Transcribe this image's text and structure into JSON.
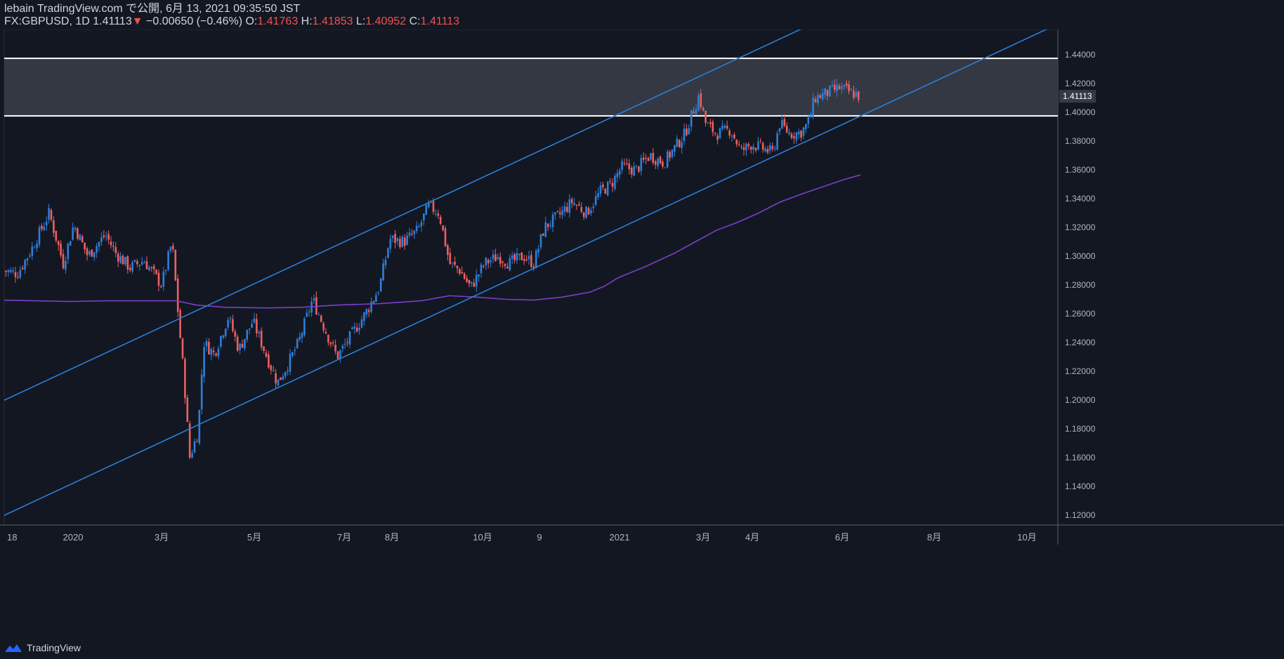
{
  "header": {
    "publish_line": "lebain TradingView.com で公開, 6月 13, 2021 09:35:50 JST",
    "symbol": "FX:GBPUSD, 1D",
    "last": "1.41113",
    "change_arrow": "▼",
    "change": "−0.00650 (−0.46%)",
    "open_label": "O:",
    "open": "1.41763",
    "high_label": "H:",
    "high": "1.41853",
    "low_label": "L:",
    "low": "1.40952",
    "close_label": "C:",
    "close": "1.41113"
  },
  "footer": {
    "brand": "TradingView"
  },
  "colors": {
    "background": "#131722",
    "up": "#2d7fd9",
    "down": "#ef5f5f",
    "channel": "#2a7fd6",
    "zone_fill": "#363a45",
    "zone_line": "#ffffff",
    "ma": "#7b3fc9",
    "price_tag": "#363a45"
  },
  "chart_data": {
    "type": "candlestick",
    "ylim": [
      1.11,
      1.45
    ],
    "y_ticks": [
      "1.44000",
      "1.42000",
      "1.40000",
      "1.38000",
      "1.36000",
      "1.34000",
      "1.32000",
      "1.30000",
      "1.28000",
      "1.26000",
      "1.24000",
      "1.22000",
      "1.20000",
      "1.18000",
      "1.16000",
      "1.14000",
      "1.12000"
    ],
    "x_ticks": [
      "18",
      "2020",
      "3月",
      "5月",
      "7月",
      "8月",
      "10月",
      "9",
      "2021",
      "3月",
      "4月",
      "6月",
      "8月",
      "10月"
    ],
    "last_price_label": "1.41113",
    "resistance_zone": [
      1.3975,
      1.4375
    ],
    "moving_average": [
      {
        "x": 0,
        "y": 1.2695
      },
      {
        "x": 50,
        "y": 1.269
      },
      {
        "x": 100,
        "y": 1.2685
      },
      {
        "x": 150,
        "y": 1.269
      },
      {
        "x": 200,
        "y": 1.269
      },
      {
        "x": 250,
        "y": 1.269
      },
      {
        "x": 280,
        "y": 1.266
      },
      {
        "x": 320,
        "y": 1.2645
      },
      {
        "x": 380,
        "y": 1.264
      },
      {
        "x": 430,
        "y": 1.2645
      },
      {
        "x": 480,
        "y": 1.266
      },
      {
        "x": 540,
        "y": 1.267
      },
      {
        "x": 600,
        "y": 1.269
      },
      {
        "x": 640,
        "y": 1.2725
      },
      {
        "x": 680,
        "y": 1.2715
      },
      {
        "x": 720,
        "y": 1.27
      },
      {
        "x": 760,
        "y": 1.2695
      },
      {
        "x": 800,
        "y": 1.2715
      },
      {
        "x": 840,
        "y": 1.275
      },
      {
        "x": 860,
        "y": 1.279
      },
      {
        "x": 880,
        "y": 1.285
      },
      {
        "x": 920,
        "y": 1.293
      },
      {
        "x": 960,
        "y": 1.302
      },
      {
        "x": 990,
        "y": 1.31
      },
      {
        "x": 1020,
        "y": 1.318
      },
      {
        "x": 1050,
        "y": 1.3235
      },
      {
        "x": 1080,
        "y": 1.33
      },
      {
        "x": 1110,
        "y": 1.3375
      },
      {
        "x": 1140,
        "y": 1.343
      },
      {
        "x": 1170,
        "y": 1.348
      },
      {
        "x": 1200,
        "y": 1.353
      },
      {
        "x": 1225,
        "y": 1.3565
      }
    ],
    "channel_lines": [
      {
        "name": "upper",
        "points": [
          {
            "x": 0,
            "y": 1.1985
          },
          {
            "x": 1150,
            "y": 1.46
          }
        ]
      },
      {
        "name": "lower",
        "points": [
          {
            "x": 0,
            "y": 1.1185
          },
          {
            "x": 1500,
            "y": 1.46
          }
        ]
      }
    ],
    "close_path": [
      {
        "x": 5,
        "y": 1.29
      },
      {
        "x": 25,
        "y": 1.288
      },
      {
        "x": 45,
        "y": 1.305
      },
      {
        "x": 70,
        "y": 1.33
      },
      {
        "x": 90,
        "y": 1.295
      },
      {
        "x": 105,
        "y": 1.322
      },
      {
        "x": 125,
        "y": 1.3
      },
      {
        "x": 150,
        "y": 1.315
      },
      {
        "x": 165,
        "y": 1.302
      },
      {
        "x": 185,
        "y": 1.292
      },
      {
        "x": 205,
        "y": 1.297
      },
      {
        "x": 230,
        "y": 1.28
      },
      {
        "x": 245,
        "y": 1.31
      },
      {
        "x": 255,
        "y": 1.252
      },
      {
        "x": 262,
        "y": 1.215
      },
      {
        "x": 270,
        "y": 1.16
      },
      {
        "x": 282,
        "y": 1.178
      },
      {
        "x": 290,
        "y": 1.24
      },
      {
        "x": 305,
        "y": 1.232
      },
      {
        "x": 325,
        "y": 1.258
      },
      {
        "x": 340,
        "y": 1.235
      },
      {
        "x": 360,
        "y": 1.255
      },
      {
        "x": 380,
        "y": 1.23
      },
      {
        "x": 395,
        "y": 1.212
      },
      {
        "x": 410,
        "y": 1.225
      },
      {
        "x": 425,
        "y": 1.24
      },
      {
        "x": 445,
        "y": 1.27
      },
      {
        "x": 462,
        "y": 1.25
      },
      {
        "x": 480,
        "y": 1.23
      },
      {
        "x": 500,
        "y": 1.245
      },
      {
        "x": 520,
        "y": 1.26
      },
      {
        "x": 540,
        "y": 1.278
      },
      {
        "x": 555,
        "y": 1.312
      },
      {
        "x": 575,
        "y": 1.31
      },
      {
        "x": 595,
        "y": 1.318
      },
      {
        "x": 610,
        "y": 1.335
      },
      {
        "x": 625,
        "y": 1.33
      },
      {
        "x": 640,
        "y": 1.295
      },
      {
        "x": 655,
        "y": 1.29
      },
      {
        "x": 670,
        "y": 1.278
      },
      {
        "x": 690,
        "y": 1.295
      },
      {
        "x": 710,
        "y": 1.3
      },
      {
        "x": 725,
        "y": 1.295
      },
      {
        "x": 745,
        "y": 1.3
      },
      {
        "x": 760,
        "y": 1.295
      },
      {
        "x": 775,
        "y": 1.32
      },
      {
        "x": 795,
        "y": 1.328
      },
      {
        "x": 815,
        "y": 1.338
      },
      {
        "x": 835,
        "y": 1.33
      },
      {
        "x": 855,
        "y": 1.345
      },
      {
        "x": 870,
        "y": 1.35
      },
      {
        "x": 885,
        "y": 1.362
      },
      {
        "x": 905,
        "y": 1.36
      },
      {
        "x": 925,
        "y": 1.37
      },
      {
        "x": 945,
        "y": 1.365
      },
      {
        "x": 960,
        "y": 1.375
      },
      {
        "x": 975,
        "y": 1.385
      },
      {
        "x": 995,
        "y": 1.412
      },
      {
        "x": 1005,
        "y": 1.392
      },
      {
        "x": 1020,
        "y": 1.385
      },
      {
        "x": 1040,
        "y": 1.388
      },
      {
        "x": 1055,
        "y": 1.373
      },
      {
        "x": 1070,
        "y": 1.378
      },
      {
        "x": 1085,
        "y": 1.375
      },
      {
        "x": 1100,
        "y": 1.372
      },
      {
        "x": 1110,
        "y": 1.392
      },
      {
        "x": 1125,
        "y": 1.385
      },
      {
        "x": 1140,
        "y": 1.386
      },
      {
        "x": 1150,
        "y": 1.392
      },
      {
        "x": 1160,
        "y": 1.41
      },
      {
        "x": 1175,
        "y": 1.413
      },
      {
        "x": 1195,
        "y": 1.417
      },
      {
        "x": 1210,
        "y": 1.414
      },
      {
        "x": 1225,
        "y": 1.411
      }
    ]
  }
}
